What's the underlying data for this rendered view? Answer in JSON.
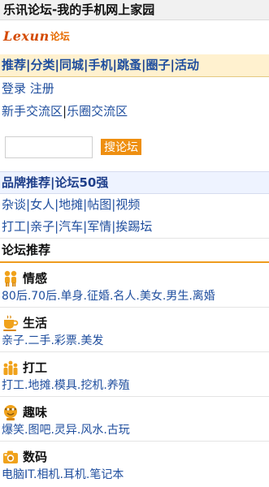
{
  "header": {
    "title": "乐讯论坛-我的手机网上家园"
  },
  "logo": {
    "en": "Lexun",
    "cn": "论坛"
  },
  "nav": {
    "items": [
      "推荐",
      "分类",
      "同城",
      "手机",
      "跳蚤",
      "圈子",
      "活动"
    ],
    "sep": "|"
  },
  "auth": {
    "login": "登录",
    "register": "注册"
  },
  "exchange": {
    "a": "新手交流区",
    "b": "乐圈交流区"
  },
  "search": {
    "value": "",
    "placeholder": "",
    "button": "搜论坛"
  },
  "brand": {
    "a": "品牌推荐",
    "b": "论坛50强"
  },
  "links_row1": [
    "杂谈",
    "女人",
    "地摊",
    "帖图",
    "视频"
  ],
  "links_row2": [
    "打工",
    "亲子",
    "汽车",
    "军情",
    "挨踢坛"
  ],
  "forum": {
    "title": "论坛推荐",
    "categories": [
      {
        "icon": "couple-icon",
        "name": "情感",
        "links": "80后.70后.单身.征婚.名人.美女.男生.离婚"
      },
      {
        "icon": "coffee-cup-icon",
        "name": "生活",
        "links": "亲子.二手.彩票.美发"
      },
      {
        "icon": "workers-icon",
        "name": "打工",
        "links": "打工.地摊.模具.挖机.养殖"
      },
      {
        "icon": "smiley-icon",
        "name": "趣味",
        "links": "爆笑.图吧.灵异.风水.古玩"
      },
      {
        "icon": "camera-icon",
        "name": "数码",
        "links": "电脑IT.相机.耳机.笔记本"
      }
    ]
  },
  "colors": {
    "accent": "#ee8f11",
    "link": "#1f4e9e",
    "nav_bg": "#fff1cf"
  }
}
